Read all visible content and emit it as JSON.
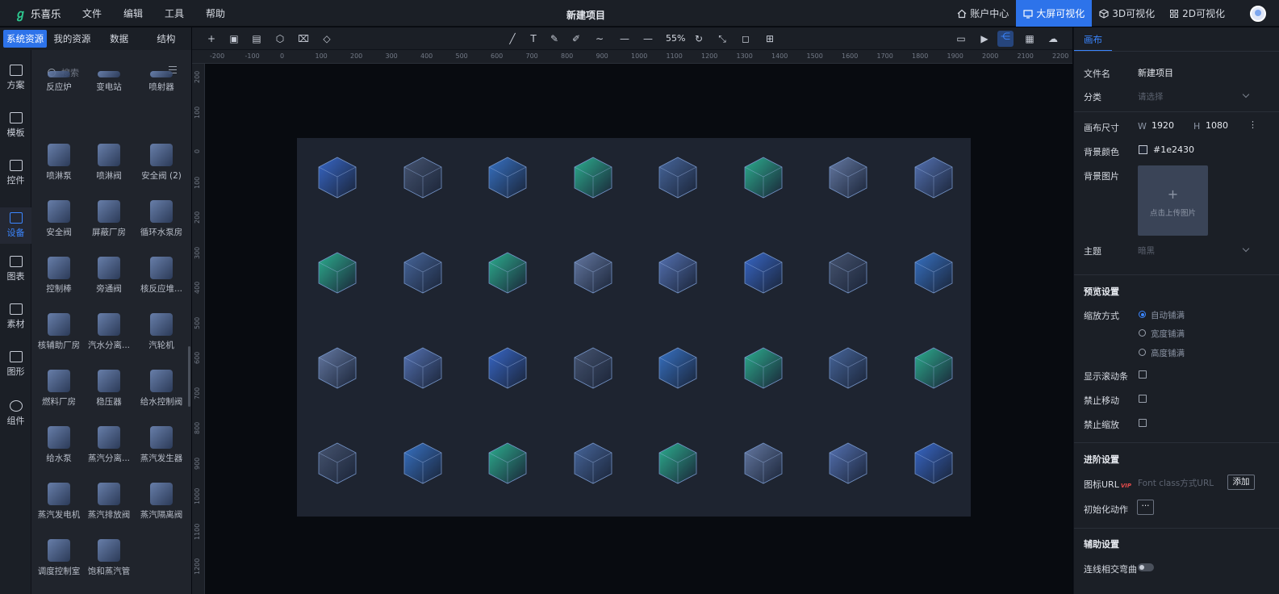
{
  "app": {
    "logo_mark": "ℊ",
    "name": "乐喜乐",
    "title": "新建项目"
  },
  "menu": [
    "文件",
    "编辑",
    "工具",
    "帮助"
  ],
  "top_right": [
    {
      "label": "账户中心",
      "icon": "home-icon",
      "active": false
    },
    {
      "label": "大屏可视化",
      "icon": "monitor-icon",
      "active": true
    },
    {
      "label": "3D可视化",
      "icon": "cube-icon",
      "active": false
    },
    {
      "label": "2D可视化",
      "icon": "grid-icon",
      "active": false
    }
  ],
  "rail": [
    {
      "label": "方案",
      "icon": "monitor-icon",
      "active": false
    },
    {
      "label": "模板",
      "icon": "template-icon",
      "active": false
    },
    {
      "label": "控件",
      "icon": "widget-icon",
      "active": false
    },
    {
      "label": "设备",
      "icon": "cube-icon",
      "active": true
    },
    {
      "label": "图表",
      "icon": "chart-icon",
      "active": false
    },
    {
      "label": "素材",
      "icon": "image-icon",
      "active": false
    },
    {
      "label": "图形",
      "icon": "shape-icon",
      "active": false
    },
    {
      "label": "组件",
      "icon": "component-icon",
      "active": false
    }
  ],
  "res_tabs": [
    {
      "label": "系统资源",
      "active": true
    },
    {
      "label": "我的资源",
      "active": false
    },
    {
      "label": "数据",
      "active": false
    },
    {
      "label": "结构",
      "active": false
    }
  ],
  "search": {
    "placeholder": "搜索"
  },
  "library": [
    "反应炉",
    "变电站",
    "喷射器",
    "喷淋泵",
    "喷淋阀",
    "安全阀 (2)",
    "安全阀",
    "屏蔽厂房",
    "循环水泵房",
    "控制棒",
    "旁通阀",
    "核反应堆...",
    "核辅助厂房",
    "汽水分离...",
    "汽轮机",
    "燃料厂房",
    "稳压器",
    "给水控制阀",
    "给水泵",
    "蒸汽分离...",
    "蒸汽发生器",
    "蒸汽发电机",
    "蒸汽排放阀",
    "蒸汽隔离阀",
    "调度控制室",
    "饱和蒸汽管"
  ],
  "toolbar": {
    "zoom": "55%"
  },
  "ruler_h": [
    "-200",
    "-100",
    "0",
    "100",
    "200",
    "300",
    "400",
    "500",
    "600",
    "700",
    "800",
    "900",
    "1000",
    "1100",
    "1200",
    "1300",
    "1400",
    "1500",
    "1600",
    "1700",
    "1800",
    "1900",
    "2000",
    "2100",
    "2200"
  ],
  "ruler_v": [
    "200",
    "100",
    "0",
    "100",
    "200",
    "300",
    "400",
    "500",
    "600",
    "700",
    "800",
    "900",
    "1000",
    "1100",
    "1200"
  ],
  "right_panel": {
    "tab": "画布",
    "file_name_label": "文件名",
    "file_name": "新建项目",
    "category_label": "分类",
    "category_placeholder": "请选择",
    "canvas_size_label": "画布尺寸",
    "w_label": "W",
    "w": "1920",
    "h_label": "H",
    "h": "1080",
    "bg_color_label": "背景颜色",
    "bg_color": "#1e2430",
    "bg_image_label": "背景图片",
    "upload_plus": "+",
    "upload_text": "点击上传图片",
    "theme_label": "主题",
    "theme_value": "暗黑",
    "preview_section": "预览设置",
    "scale_label": "缩放方式",
    "scale_options": [
      "自动铺满",
      "宽度铺满",
      "高度铺满"
    ],
    "show_scrollbar": "显示滚动条",
    "no_move": "禁止移动",
    "no_zoom": "禁止缩放",
    "advanced_section": "进阶设置",
    "icon_url_label": "图标URL",
    "vip": "VIP",
    "icon_url_placeholder": "Font class方式URL",
    "add_button": "添加",
    "init_action_label": "初始化动作",
    "more_button": "···",
    "assist_section": "辅助设置",
    "line_cross_label": "连线相交弯曲"
  },
  "colors": {
    "accent": "#2d73ea",
    "active_text": "#3b86ff",
    "brand": "#2dc78f",
    "canvas_bg": "#1e2430"
  }
}
